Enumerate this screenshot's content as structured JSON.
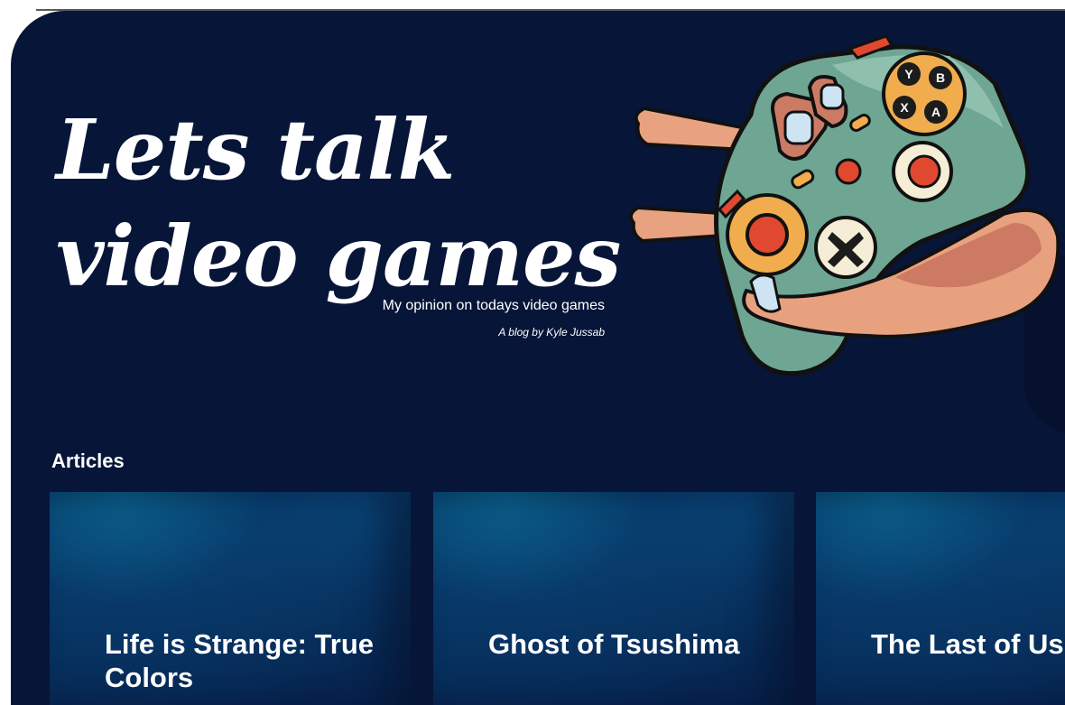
{
  "hero": {
    "title": "Lets talk video games",
    "subtitle": "My opinion on todays video games",
    "byline": "A blog by Kyle Jussab"
  },
  "illustration": {
    "icon": "game-controller-in-hand-icon",
    "buttons": [
      "Y",
      "B",
      "X",
      "A"
    ]
  },
  "articles": {
    "heading": "Articles",
    "items": [
      {
        "title": "Life is Strange: True Colors"
      },
      {
        "title": "Ghost of Tsushima"
      },
      {
        "title": "The Last of Us Part II"
      }
    ]
  },
  "colors": {
    "background": "#071538",
    "card_top": "#0b628c",
    "text": "#ffffff",
    "controller": "#6fa593",
    "button_accent": "#f0ac4d",
    "red_button": "#e0492f",
    "skin": "#e8a17f"
  }
}
